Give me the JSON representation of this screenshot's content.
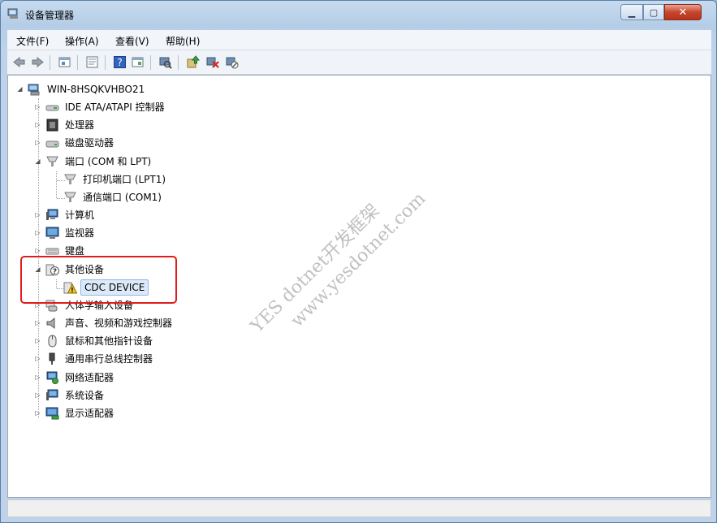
{
  "window": {
    "title": "设备管理器",
    "ctl_min": "▁",
    "ctl_max": "▢",
    "ctl_close": "✕"
  },
  "menu": {
    "items": [
      "文件(F)",
      "操作(A)",
      "查看(V)",
      "帮助(H)"
    ]
  },
  "toolbar": {
    "icons": [
      "back-icon",
      "forward-icon",
      "up-icon",
      "properties-icon",
      "help-icon",
      "show-hide-icon",
      "scan-hardware-icon",
      "update-driver-icon",
      "uninstall-icon",
      "disable-icon"
    ]
  },
  "tree": {
    "root": "WIN-8HSQKVHBO21",
    "items": [
      {
        "label": "IDE ATA/ATAPI 控制器",
        "icon": "ide-controller-icon"
      },
      {
        "label": "处理器",
        "icon": "processor-icon"
      },
      {
        "label": "磁盘驱动器",
        "icon": "disk-drive-icon"
      },
      {
        "label": "端口 (COM 和 LPT)",
        "icon": "port-icon",
        "expanded": true,
        "children": [
          "打印机端口 (LPT1)",
          "通信端口 (COM1)"
        ]
      },
      {
        "label": "计算机",
        "icon": "computer-icon"
      },
      {
        "label": "监视器",
        "icon": "monitor-icon"
      },
      {
        "label": "键盘",
        "icon": "keyboard-icon"
      },
      {
        "label": "其他设备",
        "icon": "other-devices-icon",
        "expanded": true,
        "children": [
          "CDC DEVICE"
        ]
      },
      {
        "label": "人体学输入设备",
        "icon": "hid-icon"
      },
      {
        "label": "声音、视频和游戏控制器",
        "icon": "sound-icon"
      },
      {
        "label": "鼠标和其他指针设备",
        "icon": "mouse-icon"
      },
      {
        "label": "通用串行总线控制器",
        "icon": "usb-icon"
      },
      {
        "label": "网络适配器",
        "icon": "network-adapter-icon"
      },
      {
        "label": "系统设备",
        "icon": "system-devices-icon"
      },
      {
        "label": "显示适配器",
        "icon": "display-adapter-icon"
      }
    ]
  },
  "watermark": {
    "line1": "YES dotnet开发框架",
    "line2": "www.yesdotnet.com"
  },
  "colors": {
    "highlight": "#e01c1c",
    "selection_bg": "#dce9f8",
    "warning": "#f3c623"
  }
}
